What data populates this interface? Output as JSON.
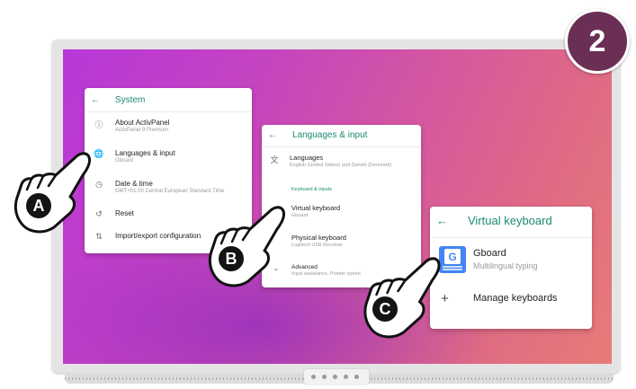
{
  "step_badge": "2",
  "system_panel": {
    "title": "System",
    "items": [
      {
        "label": "About ActivPanel",
        "sub": "ActivPanel 9 Premium",
        "icon": "info-icon"
      },
      {
        "label": "Languages & input",
        "sub": "Gboard",
        "icon": "globe-icon"
      },
      {
        "label": "Date & time",
        "sub": "GMT+01:00 Central European Standard Time",
        "icon": "clock-icon"
      },
      {
        "label": "Reset",
        "sub": "",
        "icon": "history-icon"
      },
      {
        "label": "Import/export configuration",
        "sub": "",
        "icon": "import-export-icon"
      }
    ]
  },
  "languages_panel": {
    "title": "Languages & input",
    "languages": {
      "label": "Languages",
      "sub": "English (United States) and Danish (Denmark)"
    },
    "section": "Keyboard & inputs",
    "virtual_keyboard": {
      "label": "Virtual keyboard",
      "sub": "Gboard"
    },
    "physical_keyboard": {
      "label": "Physical keyboard",
      "sub": "Logitech USB Receiver"
    },
    "advanced": {
      "label": "Advanced",
      "sub": "Input assistance, Pointer speed"
    }
  },
  "vk_panel": {
    "title": "Virtual keyboard",
    "gboard": {
      "label": "Gboard",
      "sub": "Multilingual typing"
    },
    "manage": "Manage keyboards"
  },
  "callouts": {
    "a": "A",
    "b": "B",
    "c": "C"
  }
}
